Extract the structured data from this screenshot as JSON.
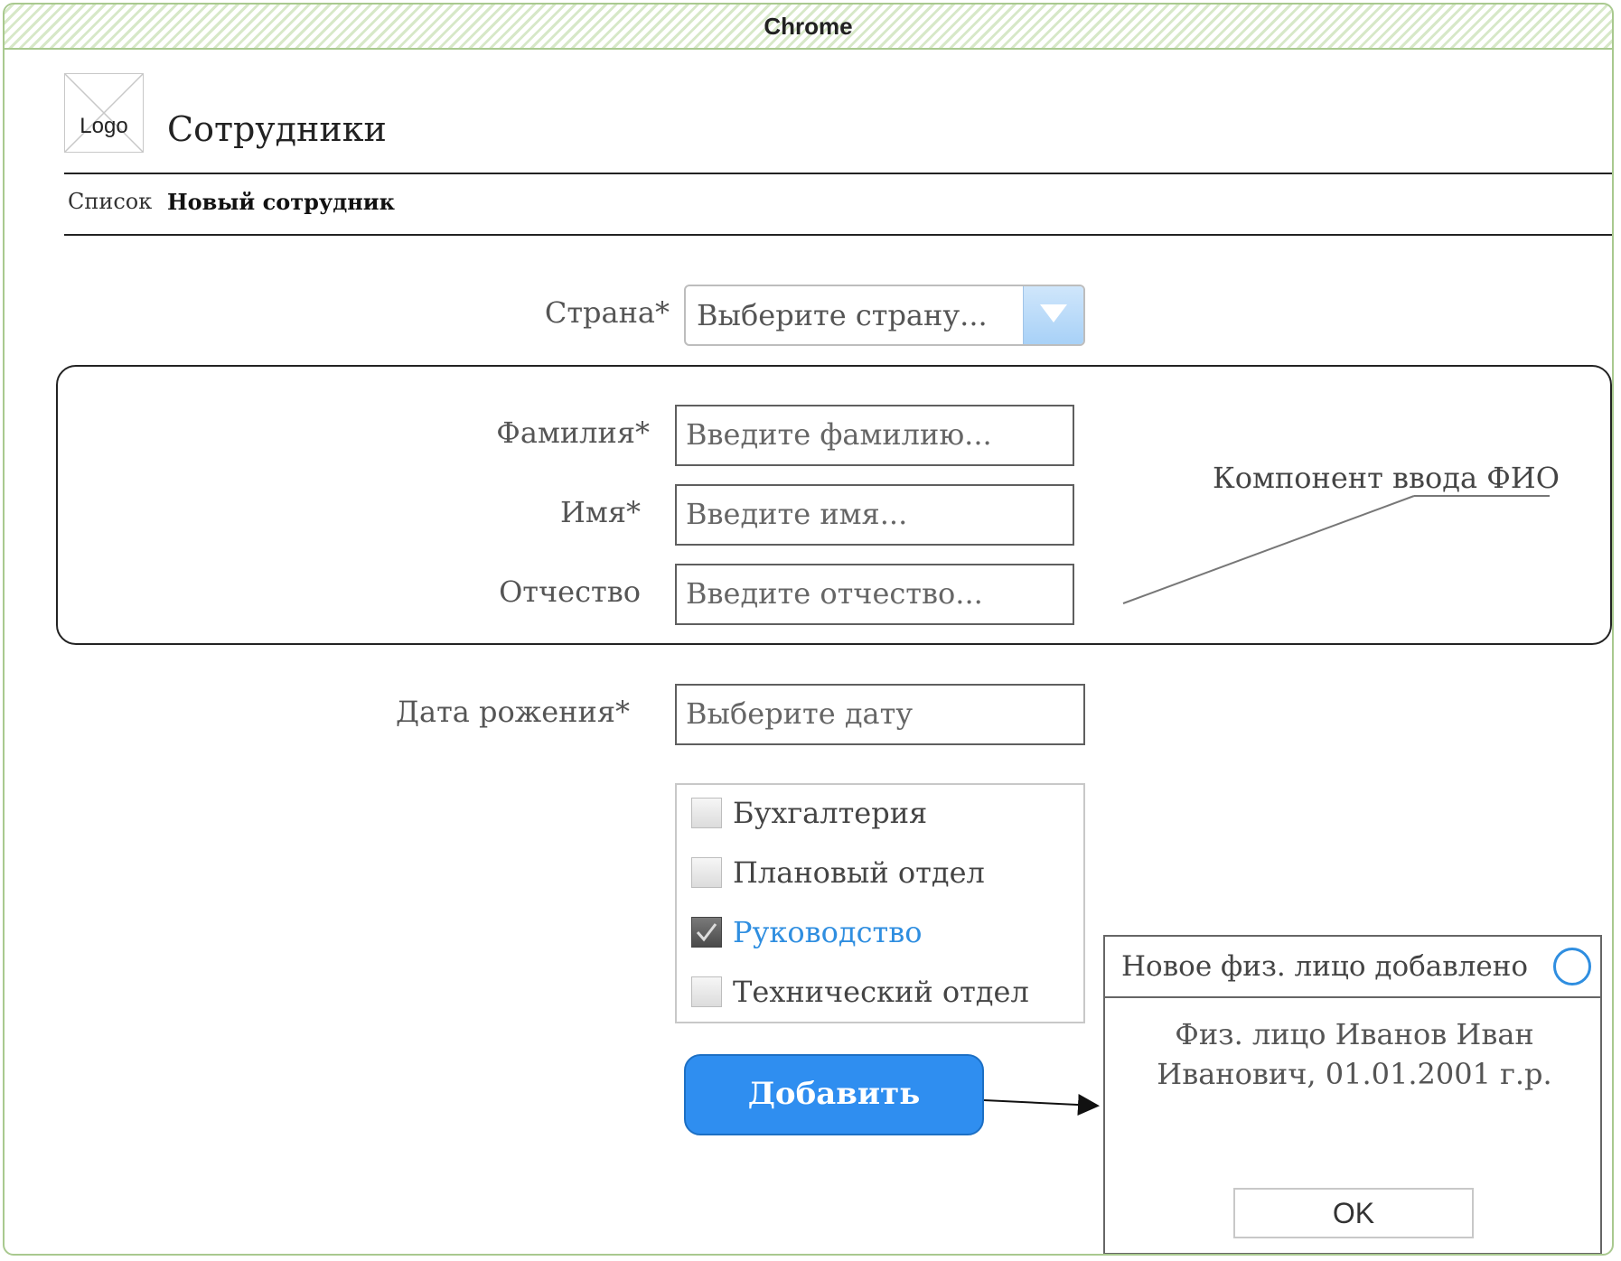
{
  "window": {
    "title": "Chrome"
  },
  "header": {
    "logo_text": "Logo",
    "page_title": "Сотрудники"
  },
  "breadcrumb": {
    "items": [
      "Список",
      "Новый сотрудник"
    ]
  },
  "form": {
    "country": {
      "label": "Страна*",
      "placeholder": "Выберите страну..."
    },
    "fio_component": {
      "callout": "Компонент ввода ФИО",
      "last_name": {
        "label": "Фамилия*",
        "placeholder": "Введите фамилию..."
      },
      "first_name": {
        "label": "Имя*",
        "placeholder": "Введите имя..."
      },
      "patronymic": {
        "label": "Отчество",
        "placeholder": "Введите отчество..."
      }
    },
    "birth_date": {
      "label": "Дата рожения*",
      "placeholder": "Выберите дату"
    },
    "departments": [
      {
        "label": "Бухгалтерия",
        "checked": false
      },
      {
        "label": "Плановый отдел",
        "checked": false
      },
      {
        "label": "Руководство",
        "checked": true
      },
      {
        "label": "Технический отдел",
        "checked": false
      }
    ],
    "submit_label": "Добавить"
  },
  "dialog": {
    "title": "Новое физ. лицо добавлено",
    "message": "Физ. лицо Иванов Иван Иванович, 01.01.2001 г.р.",
    "ok_label": "OK"
  },
  "colors": {
    "accent": "#2f8ef0",
    "window_border": "#a9c98f",
    "link_active": "#2f8ee0"
  }
}
